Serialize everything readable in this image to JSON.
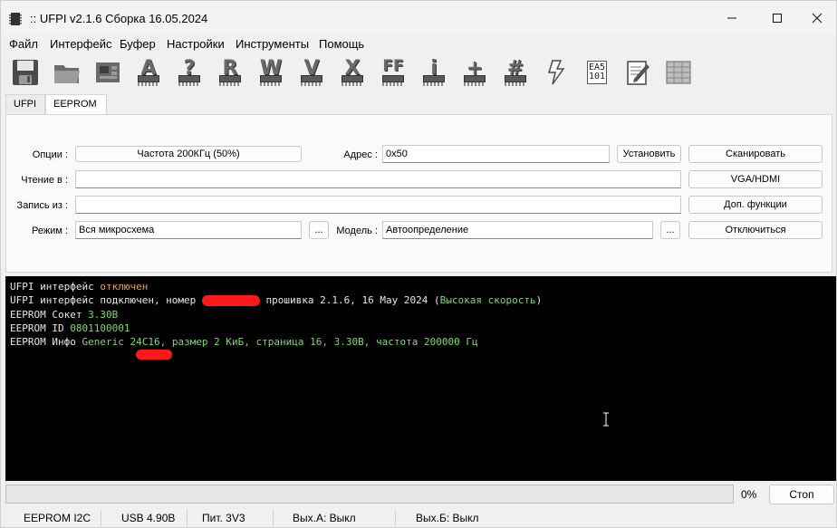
{
  "window": {
    "title": ":: UFPI v2.1.6 Сборка 16.05.2024"
  },
  "menu": [
    "Файл",
    "Интерфейс",
    "Буфер",
    "Настройки",
    "Инструменты",
    "Помощь"
  ],
  "toolbar": {
    "icons": [
      "save-icon",
      "open-folder-icon",
      "chip-board-icon",
      "chip-a-icon",
      "chip-question-icon",
      "chip-r-icon",
      "chip-w-icon",
      "chip-v-icon",
      "chip-x-icon",
      "chip-ff-icon",
      "chip-i-icon",
      "chip-plus-icon",
      "chip-hash-icon",
      "lightning-icon",
      "hex-box-icon",
      "editor-icon",
      "buffer-icon"
    ],
    "glyphs": [
      "",
      "",
      "",
      "A",
      "?",
      "R",
      "W",
      "V",
      "X",
      "FF",
      "i",
      "+",
      "#",
      "",
      "",
      "",
      ""
    ],
    "hex_box_text": [
      "EA5",
      "101"
    ]
  },
  "tabs": [
    "UFPI",
    "EEPROM"
  ],
  "active_tab": "EEPROM",
  "form": {
    "options_label": "Опции :",
    "options_button": "Частота 200КГц (50%)",
    "address_label": "Адрес :",
    "address_value": "0x50",
    "set_button": "Установить",
    "scan_button": "Сканировать",
    "read_label": "Чтение в :",
    "read_value": "",
    "vga_button": "VGA/HDMI",
    "write_label": "Запись из :",
    "write_value": "",
    "extra_button": "Доп. функции",
    "mode_label": "Режим :",
    "mode_value": "Вся микросхема",
    "mode_browse": "...",
    "model_label": "Модель :",
    "model_value": "Автоопределение",
    "model_browse": "...",
    "disconnect_button": "Отключиться"
  },
  "console": {
    "lines": [
      [
        {
          "t": "UFPI интерфейс ",
          "c": "w"
        },
        {
          "t": "отключен",
          "c": "o"
        }
      ],
      [
        {
          "t": "UFPI интерфейс подключен, номер ",
          "c": "w"
        },
        {
          "t": "",
          "c": "redact"
        },
        {
          "t": " прошивка 2.1.6, 16 May 2024 (",
          "c": "w"
        },
        {
          "t": "Высокая скорость",
          "c": "g"
        },
        {
          "t": ")",
          "c": "w"
        }
      ],
      [
        {
          "t": "EEPROM Сокет ",
          "c": "w"
        },
        {
          "t": "3.30В",
          "c": "g"
        }
      ],
      [
        {
          "t": "EEPROM ID ",
          "c": "w"
        },
        {
          "t": "0801100001",
          "c": "g"
        }
      ],
      [
        {
          "t": "EEPROM Инфо ",
          "c": "w"
        },
        {
          "t": "Generic 24C16, размер 2 КиБ, страница 16, 3.30В, частота 200000 Гц",
          "c": "g"
        }
      ]
    ]
  },
  "progress": {
    "value": 0,
    "label": "0%"
  },
  "stop_button": "Стоп",
  "status": [
    "EEPROM I2C",
    "USB 4.90В",
    "Пит. 3V3",
    "Вых.А: Выкл",
    "Вых.Б: Выкл"
  ]
}
